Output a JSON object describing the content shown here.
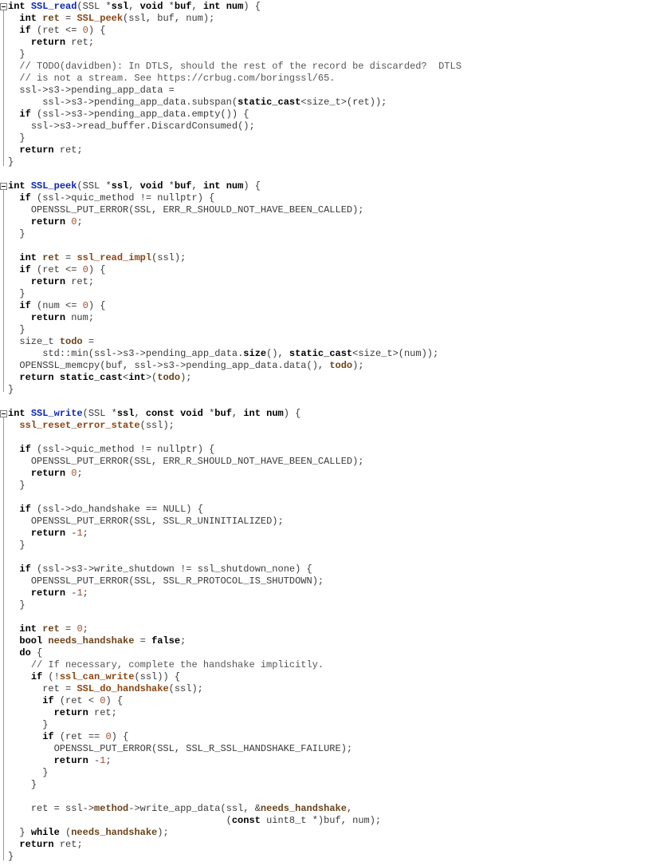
{
  "editor": {
    "language": "C++",
    "lines": [
      "int SSL_read(SSL *ssl, void *buf, int num) {",
      "  int ret = SSL_peek(ssl, buf, num);",
      "  if (ret <= 0) {",
      "    return ret;",
      "  }",
      "  // TODO(davidben): In DTLS, should the rest of the record be discarded?  DTLS",
      "  // is not a stream. See https://crbug.com/boringssl/65.",
      "  ssl->s3->pending_app_data =",
      "      ssl->s3->pending_app_data.subspan(static_cast<size_t>(ret));",
      "  if (ssl->s3->pending_app_data.empty()) {",
      "    ssl->s3->read_buffer.DiscardConsumed();",
      "  }",
      "  return ret;",
      "}",
      "",
      "int SSL_peek(SSL *ssl, void *buf, int num) {",
      "  if (ssl->quic_method != nullptr) {",
      "    OPENSSL_PUT_ERROR(SSL, ERR_R_SHOULD_NOT_HAVE_BEEN_CALLED);",
      "    return 0;",
      "  }",
      "",
      "  int ret = ssl_read_impl(ssl);",
      "  if (ret <= 0) {",
      "    return ret;",
      "  }",
      "  if (num <= 0) {",
      "    return num;",
      "  }",
      "  size_t todo =",
      "      std::min(ssl->s3->pending_app_data.size(), static_cast<size_t>(num));",
      "  OPENSSL_memcpy(buf, ssl->s3->pending_app_data.data(), todo);",
      "  return static_cast<int>(todo);",
      "}",
      "",
      "int SSL_write(SSL *ssl, const void *buf, int num) {",
      "  ssl_reset_error_state(ssl);",
      "",
      "  if (ssl->quic_method != nullptr) {",
      "    OPENSSL_PUT_ERROR(SSL, ERR_R_SHOULD_NOT_HAVE_BEEN_CALLED);",
      "    return 0;",
      "  }",
      "",
      "  if (ssl->do_handshake == NULL) {",
      "    OPENSSL_PUT_ERROR(SSL, SSL_R_UNINITIALIZED);",
      "    return -1;",
      "  }",
      "",
      "  if (ssl->s3->write_shutdown != ssl_shutdown_none) {",
      "    OPENSSL_PUT_ERROR(SSL, SSL_R_PROTOCOL_IS_SHUTDOWN);",
      "    return -1;",
      "  }",
      "",
      "  int ret = 0;",
      "  bool needs_handshake = false;",
      "  do {",
      "    // If necessary, complete the handshake implicitly.",
      "    if (!ssl_can_write(ssl)) {",
      "      ret = SSL_do_handshake(ssl);",
      "      if (ret < 0) {",
      "        return ret;",
      "      }",
      "      if (ret == 0) {",
      "        OPENSSL_PUT_ERROR(SSL, SSL_R_SSL_HANDSHAKE_FAILURE);",
      "        return -1;",
      "      }",
      "    }",
      "",
      "    ret = ssl->method->write_app_data(ssl, &needs_handshake,",
      "                                      (const uint8_t *)buf, num);",
      "  } while (needs_handshake);",
      "  return ret;",
      "}"
    ]
  }
}
